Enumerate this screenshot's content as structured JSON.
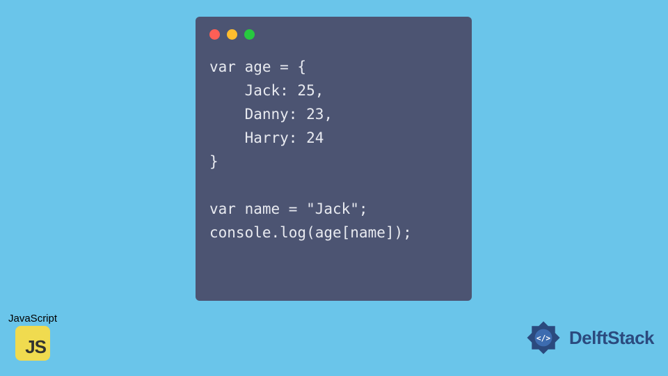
{
  "code": {
    "lines": [
      "var age = {",
      "    Jack: 25,",
      "    Danny: 23,",
      "    Harry: 24",
      "}",
      "",
      "var name = \"Jack\";",
      "console.log(age[name]);"
    ]
  },
  "js_badge": {
    "label": "JavaScript",
    "logo_text": "JS"
  },
  "delft_badge": {
    "text": "DelftStack"
  },
  "colors": {
    "background": "#6ac5ea",
    "code_window": "#4c5472",
    "js_yellow": "#f0db4f",
    "delft_blue": "#2b4a7e"
  }
}
